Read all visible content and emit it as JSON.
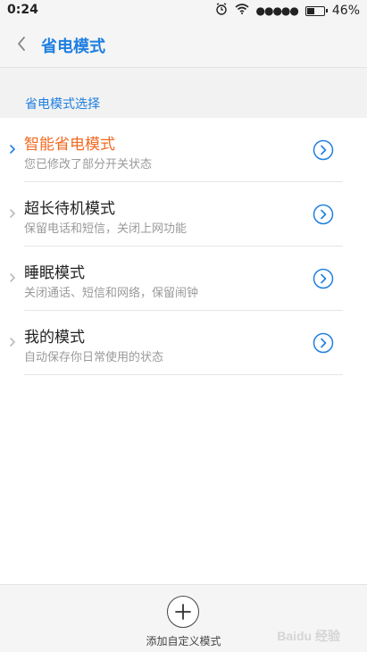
{
  "status_bar": {
    "time": "0:24",
    "signal_dots": "●●●●●",
    "battery_percent": "46%",
    "battery_level": 0.46
  },
  "header": {
    "title": "省电模式"
  },
  "section": {
    "label": "省电模式选择"
  },
  "modes": [
    {
      "title": "智能省电模式",
      "subtitle": "您已修改了部分开关状态",
      "selected": true
    },
    {
      "title": "超长待机模式",
      "subtitle": "保留电话和短信，关闭上网功能",
      "selected": false
    },
    {
      "title": "睡眠模式",
      "subtitle": "关闭通话、短信和网络，保留闹钟",
      "selected": false
    },
    {
      "title": "我的模式",
      "subtitle": "自动保存你日常使用的状态",
      "selected": false
    }
  ],
  "footer": {
    "add_label": "添加自定义模式"
  },
  "watermark": "Baidu 经验",
  "colors": {
    "accent": "#1e7fe0",
    "selected": "#f06a22"
  },
  "icons": {
    "back": "chevron-left-icon",
    "detail": "circle-chevron-right-icon",
    "add": "plus-icon"
  }
}
